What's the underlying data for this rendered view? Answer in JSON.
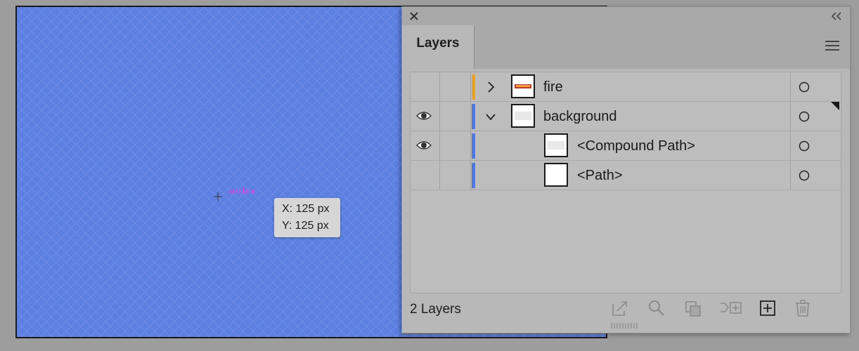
{
  "canvas": {
    "anchor_label": "anchor",
    "tooltip": {
      "x": "X: 125 px",
      "y": "Y: 125 px"
    }
  },
  "panel": {
    "tab_label": "Layers",
    "footer_count": "2 Layers",
    "footer_icons": [
      "collect-for-export-icon",
      "locate-object-icon",
      "make-clipping-mask-icon",
      "create-sublayer-icon",
      "new-layer-icon",
      "trash-icon"
    ],
    "rows": [
      {
        "name": "fire",
        "visible": false,
        "color": "#f0a020",
        "expanded": false,
        "level": 0,
        "thumbnail": "fire-thumbnail"
      },
      {
        "name": "background",
        "visible": true,
        "color": "#4a78ee",
        "expanded": true,
        "level": 0,
        "thumbnail": "background-thumbnail"
      },
      {
        "name": "<Compound Path>",
        "visible": true,
        "color": "#4a78ee",
        "level": 1,
        "thumbnail": "compound-path-thumbnail"
      },
      {
        "name": "<Path>",
        "visible": false,
        "color": "#4a78ee",
        "level": 1,
        "thumbnail": "path-thumbnail"
      }
    ]
  },
  "colors": {
    "panel_bg": "#b8b8b8",
    "canvas_grid": "#5b80e2",
    "anchor": "#e040e0"
  }
}
